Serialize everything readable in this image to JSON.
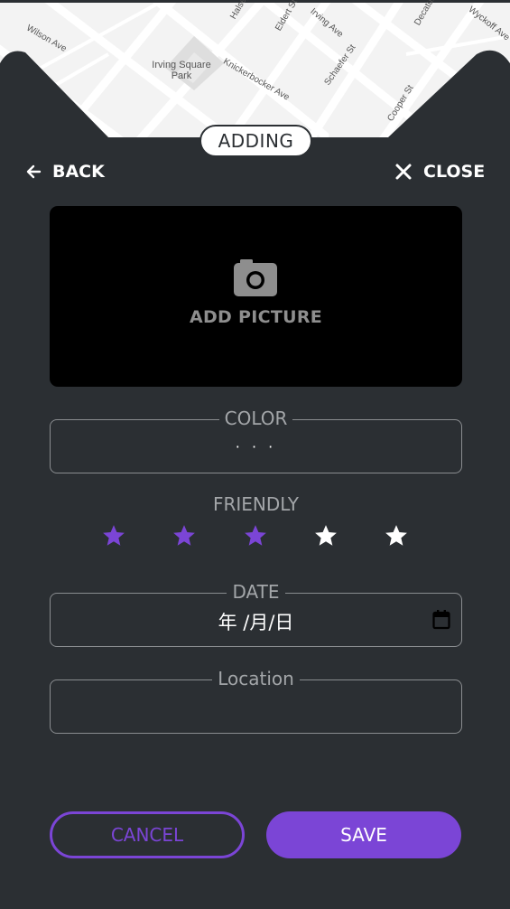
{
  "map": {
    "street_labels": [
      "Wilson Ave",
      "Halsey St",
      "Eldert St",
      "Irving Ave",
      "Decatur St",
      "Knickerbocker Ave",
      "Schaefer St",
      "Cooper St",
      "Irving Square Park",
      "Wyckoff Ave"
    ]
  },
  "header": {
    "mode_badge": "ADDING",
    "back_label": "BACK",
    "close_label": "CLOSE"
  },
  "picture": {
    "label": "ADD PICTURE",
    "icon": "camera-icon"
  },
  "fields": {
    "color": {
      "label": "COLOR",
      "value": "· · ·"
    },
    "friendly": {
      "label": "FRIENDLY",
      "rating": 3,
      "max": 5
    },
    "date": {
      "label": "DATE",
      "value": "年 /月/日"
    },
    "location": {
      "label": "Location",
      "value": ""
    }
  },
  "actions": {
    "cancel_label": "CANCEL",
    "save_label": "SAVE"
  },
  "colors": {
    "background": "#2b2f33",
    "accent": "#7b45d6",
    "star_empty": "#ffffff",
    "muted_text": "#a3a6a9"
  }
}
